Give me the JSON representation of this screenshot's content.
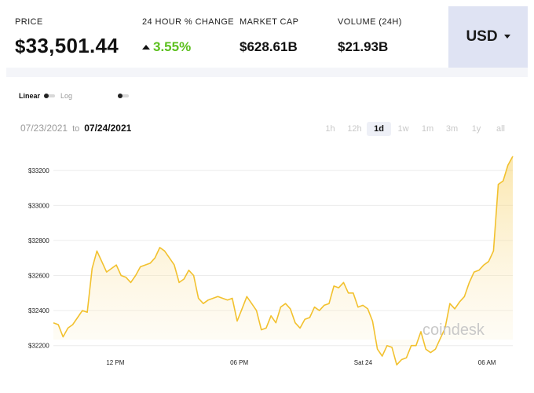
{
  "stats": {
    "price": {
      "label": "PRICE",
      "symbol": "$",
      "value": "33,501.44"
    },
    "change": {
      "label": "24 HOUR % CHANGE",
      "value": "3.55%",
      "direction": "up"
    },
    "market_cap": {
      "label": "MARKET CAP",
      "value": "$628.61B"
    },
    "volume": {
      "label": "VOLUME (24H)",
      "value": "$21.93B"
    }
  },
  "currency": {
    "label": "USD"
  },
  "scale": {
    "linear": "Linear",
    "log": "Log"
  },
  "date_range": {
    "from": "07/23/2021",
    "separator": "to",
    "to": "07/24/2021"
  },
  "ranges": [
    "1h",
    "12h",
    "1d",
    "1w",
    "1m",
    "3m",
    "1y",
    "all"
  ],
  "active_range": "1d",
  "watermark": "coindesk",
  "colors": {
    "accent": "#f2c12e",
    "positive": "#5cc01e",
    "currency_bg": "#dfe3f3"
  },
  "chart_data": {
    "type": "area",
    "ylim": [
      32100,
      33320
    ],
    "yticks": [
      {
        "value": 32200,
        "label": "$32200"
      },
      {
        "value": 32400,
        "label": "$32400"
      },
      {
        "value": 32600,
        "label": "$32600"
      },
      {
        "value": 32800,
        "label": "$32800"
      },
      {
        "value": 33000,
        "label": "$33000"
      },
      {
        "value": 33200,
        "label": "$33200"
      }
    ],
    "x_start": "2021-07-23T09:00",
    "x_end": "2021-07-24T07:15",
    "xticks": [
      {
        "value": "2021-07-23T12:00",
        "label": "12 PM"
      },
      {
        "value": "2021-07-23T18:00",
        "label": "06 PM"
      },
      {
        "value": "2021-07-24T00:00",
        "label": "Sat 24"
      },
      {
        "value": "2021-07-24T06:00",
        "label": "06 AM"
      }
    ],
    "grid": true,
    "series": [
      {
        "values": [
          32330,
          32320,
          32250,
          32300,
          32320,
          32360,
          32400,
          32390,
          32640,
          32740,
          32680,
          32620,
          32640,
          32660,
          32600,
          32590,
          32560,
          32600,
          32650,
          32660,
          32670,
          32700,
          32760,
          32740,
          32700,
          32660,
          32560,
          32580,
          32630,
          32600,
          32470,
          32440,
          32460,
          32470,
          32480,
          32470,
          32460,
          32470,
          32340,
          32410,
          32480,
          32440,
          32400,
          32290,
          32300,
          32370,
          32330,
          32420,
          32440,
          32410,
          32330,
          32300,
          32350,
          32360,
          32420,
          32400,
          32430,
          32440,
          32540,
          32530,
          32560,
          32500,
          32500,
          32420,
          32430,
          32410,
          32340,
          32180,
          32140,
          32200,
          32190,
          32090,
          32120,
          32130,
          32200,
          32200,
          32280,
          32180,
          32160,
          32180,
          32240,
          32300,
          32440,
          32410,
          32450,
          32480,
          32560,
          32620,
          32630,
          32660,
          32680,
          32740,
          33120,
          33140,
          33230,
          33280
        ]
      }
    ]
  }
}
